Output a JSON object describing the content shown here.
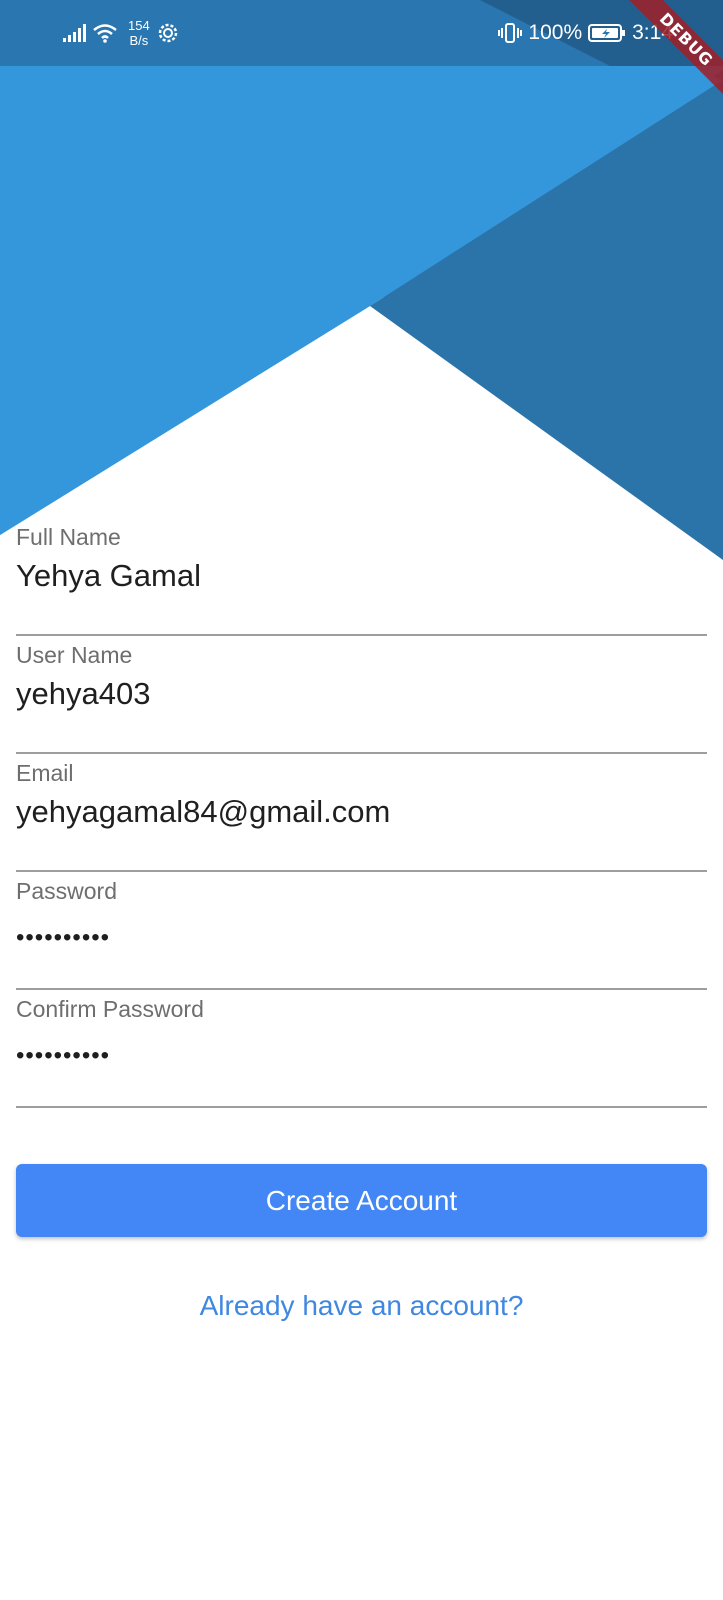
{
  "colors": {
    "header_light_blue": "#3597db",
    "header_dark_blue": "#2b74aa",
    "status_bar_blue": "#2a76b0",
    "button_blue": "#4287f5",
    "link_blue": "#3f87e0"
  },
  "status_bar": {
    "net_speed_value": "154",
    "net_speed_unit": "B/s",
    "battery": "100%",
    "time": "3:14",
    "icons": [
      "signal-icon",
      "wifi-icon",
      "settings-gear-icon",
      "vibrate-icon",
      "battery-charging-icon"
    ]
  },
  "debug_banner": "DEBUG",
  "form": {
    "fields": [
      {
        "label": "Full Name",
        "value": "Yehya Gamal"
      },
      {
        "label": "User Name",
        "value": "yehya403"
      },
      {
        "label": "Email",
        "value": "yehyagamal84@gmail.com"
      },
      {
        "label": "Password",
        "value": "••••••••••"
      },
      {
        "label": "Confirm Password",
        "value": "••••••••••"
      }
    ]
  },
  "actions": {
    "create_account": "Create Account",
    "login_link": "Already have an account?"
  }
}
